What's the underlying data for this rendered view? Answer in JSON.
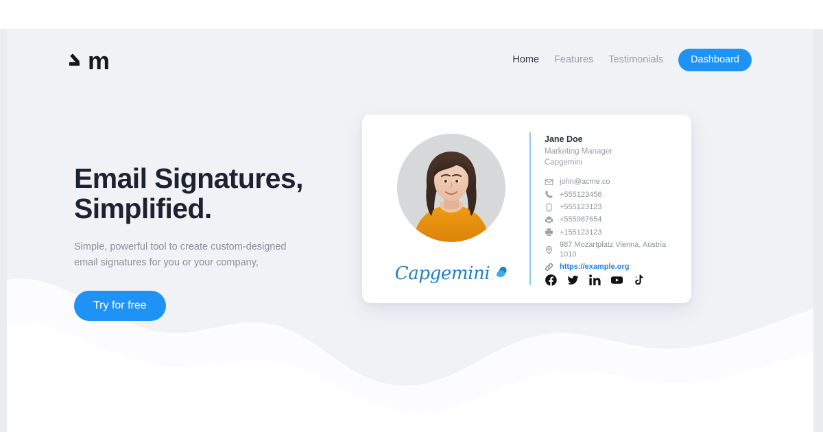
{
  "brand": {
    "logo_word": "m",
    "logo_mark": "angled-slash-mark"
  },
  "nav": {
    "items": [
      {
        "label": "Home",
        "active": true
      },
      {
        "label": "Features",
        "active": false
      },
      {
        "label": "Testimonials",
        "active": false
      }
    ],
    "cta_label": "Dashboard"
  },
  "hero": {
    "title": "Email Signatures,\nSimplified.",
    "subtitle": "Simple, powerful tool to create custom-designed email signatures for you or your company,",
    "cta_label": "Try for free"
  },
  "signature_card": {
    "avatar_alt": "portrait-woman-orange-sweater",
    "company_logo_word": "Capgemini",
    "name": "Jane Doe",
    "role": "Marketing Manager",
    "company": "Capgemini",
    "contacts": [
      {
        "icon": "envelope-icon",
        "text": "john@acme.co",
        "is_link": false
      },
      {
        "icon": "phone-icon",
        "text": "+555123456",
        "is_link": false
      },
      {
        "icon": "mobile-icon",
        "text": "+555123123",
        "is_link": false
      },
      {
        "icon": "telephone-icon",
        "text": "+555987654",
        "is_link": false
      },
      {
        "icon": "fax-icon",
        "text": "+155123123",
        "is_link": false
      },
      {
        "icon": "location-pin-icon",
        "text": "987 Mozartplatz Vienna, Austria 1010",
        "is_link": false
      },
      {
        "icon": "link-icon",
        "text": "https://example.org",
        "is_link": true
      }
    ],
    "socials": [
      {
        "name": "facebook-icon"
      },
      {
        "name": "twitter-icon"
      },
      {
        "name": "linkedin-icon"
      },
      {
        "name": "youtube-icon"
      },
      {
        "name": "tiktok-icon"
      }
    ]
  },
  "colors": {
    "accent_blue": "#1f93f5",
    "link_blue": "#1f7fe8",
    "page_bg": "#f1f2f6",
    "card_bg": "#ffffff",
    "heading": "#1c2230",
    "muted_text": "#8b9099",
    "divider_blue": "#8fc8f0",
    "capgemini_blue": "#1e7fc4",
    "sweater_orange": "#e8920f"
  }
}
